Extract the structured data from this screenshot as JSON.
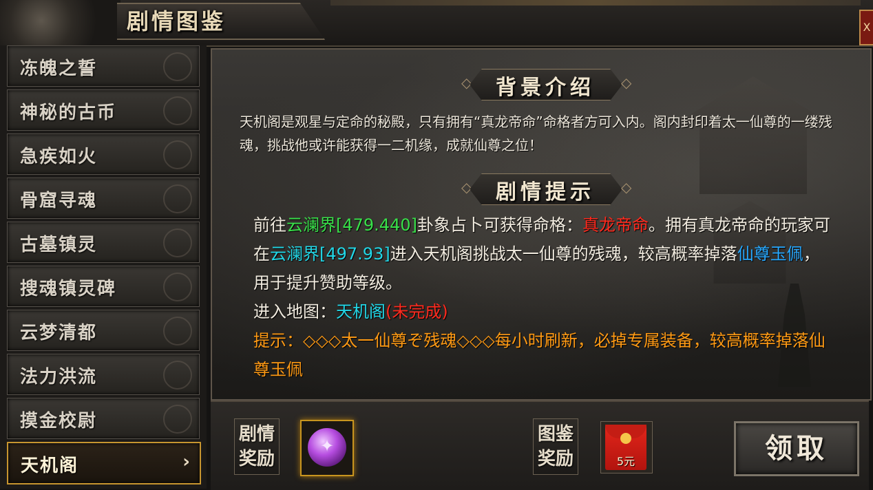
{
  "window": {
    "title": "剧情图鉴",
    "close_label": "X"
  },
  "sidebar": {
    "items": [
      {
        "label": "冻魄之誓",
        "active": false
      },
      {
        "label": "神秘的古币",
        "active": false
      },
      {
        "label": "急疾如火",
        "active": false
      },
      {
        "label": "骨窟寻魂",
        "active": false
      },
      {
        "label": "古墓镇灵",
        "active": false
      },
      {
        "label": "搜魂镇灵碑",
        "active": false
      },
      {
        "label": "云梦清都",
        "active": false
      },
      {
        "label": "法力洪流",
        "active": false
      },
      {
        "label": "摸金校尉",
        "active": false
      },
      {
        "label": "天机阁",
        "active": true
      }
    ],
    "active_chevron": "›"
  },
  "background": {
    "header": "背景介绍",
    "text": "天机阁是观星与定命的秘殿，只有拥有“真龙帝命”命格者方可入内。阁内封印着太一仙尊的一缕残魂，挑战他或许能获得一二机缘，成就仙尊之位！"
  },
  "hint": {
    "header": "剧情提示",
    "p1_a": "前往",
    "p1_loc": "云澜界[479.440]",
    "p1_b": "卦象占卜可获得命格：",
    "p1_fate": "真龙帝命",
    "p1_c": "。拥有真龙帝命的玩家可在",
    "p1_loc2": "云澜界[497.93]",
    "p1_d": "进入天机阁挑战太一仙尊的残魂，较高概率掉落",
    "p1_item": "仙尊玉佩",
    "p1_e": "，用于提升赞助等级。",
    "map_label": "进入地图：",
    "map_name": "天机阁",
    "map_status": "(未完成)",
    "tip": "提示：◇◇◇太一仙尊ぞ残魂◇◇◇每小时刷新，必掉专属装备，较高概率掉落仙尊玉佩"
  },
  "rewards": {
    "story_label_1": "剧情",
    "story_label_2": "奖励",
    "story_item_icon": "purple-orb-icon",
    "album_label_1": "图鉴",
    "album_label_2": "奖励",
    "album_item_icon": "red-envelope-icon",
    "album_item_amount": "5元",
    "claim_label": "领取"
  },
  "colors": {
    "location": "#39e04a",
    "location2": "#22d6e6",
    "fate": "#ff2a1e",
    "item": "#27a8ff",
    "tip": "#ff9a14",
    "active_border": "#c7952f"
  }
}
